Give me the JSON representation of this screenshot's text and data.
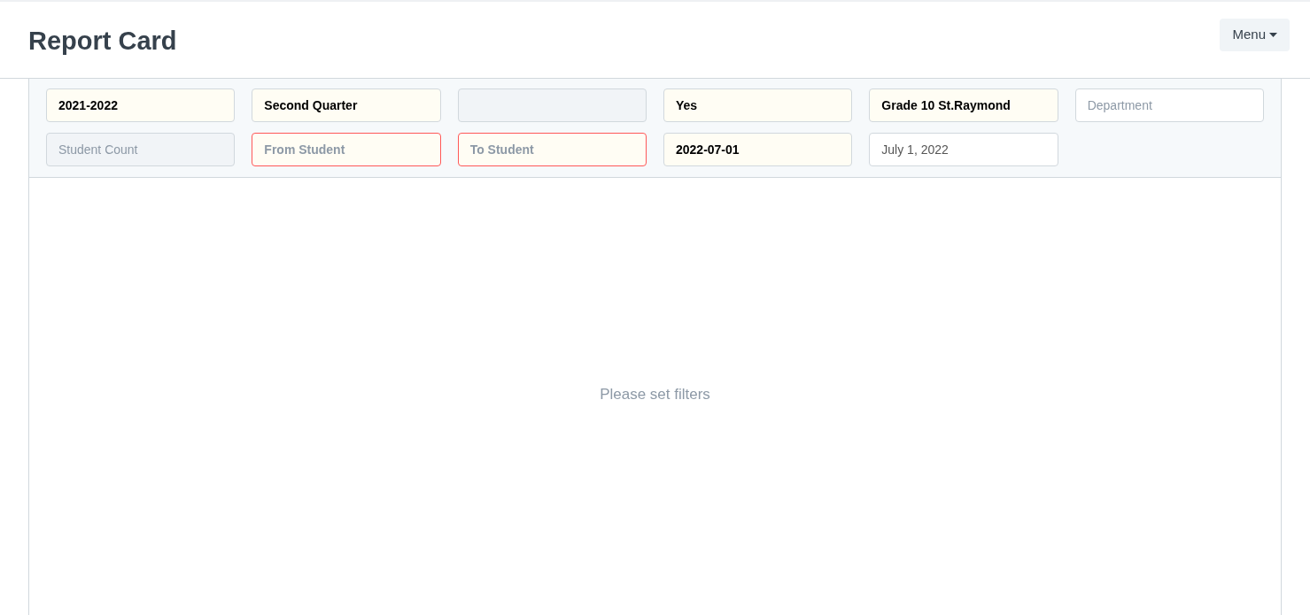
{
  "header": {
    "title": "Report Card",
    "menu_button": "Menu"
  },
  "filters": [
    {
      "value": "2021-2022",
      "required": true,
      "error": false,
      "disabled": false
    },
    {
      "value": "Second Quarter",
      "required": true,
      "error": false,
      "disabled": false
    },
    {
      "required": false,
      "error": false,
      "disabled": true
    },
    {
      "value": "Yes",
      "required": true,
      "error": false,
      "disabled": false
    },
    {
      "value": "Grade 10 St.Raymond",
      "required": true,
      "error": false,
      "disabled": false
    },
    {
      "placeholder": "Department",
      "required": false,
      "error": false,
      "disabled": false
    },
    {
      "placeholder": "Student Count",
      "required": false,
      "error": false,
      "disabled": true
    },
    {
      "placeholder": "From Student",
      "required": true,
      "error": true,
      "disabled": false
    },
    {
      "placeholder": "To Student",
      "required": true,
      "error": true,
      "disabled": false
    },
    {
      "value": "2022-07-01",
      "required": true,
      "error": false,
      "disabled": false
    },
    {
      "value": "July 1, 2022",
      "required": false,
      "error": false,
      "disabled": false
    }
  ],
  "empty_message": "Please set filters"
}
